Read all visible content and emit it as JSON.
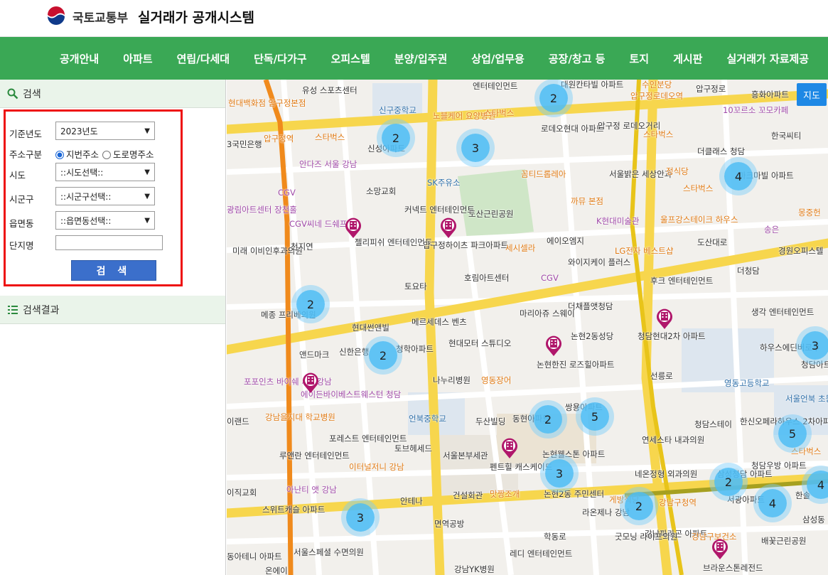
{
  "header": {
    "ministry": "국토교통부",
    "system_title": "실거래가 공개시스템"
  },
  "nav": [
    "공개안내",
    "아파트",
    "연립/다세대",
    "단독/다가구",
    "오피스텔",
    "분양/입주권",
    "상업/업무용",
    "공장/창고 등",
    "토지",
    "게시판",
    "실거래가 자료제공"
  ],
  "search": {
    "title": "검색",
    "year_label": "기준년도",
    "year_value": "2023년도",
    "addr_label": "주소구분",
    "addr_opt1": "지번주소",
    "addr_opt2": "도로명주소",
    "sido_label": "시도",
    "sido_value": "::시도선택::",
    "sigungu_label": "시군구",
    "sigungu_value": "::시군구선택::",
    "dong_label": "읍면동",
    "dong_value": "::읍면동선택::",
    "danji_label": "단지명",
    "danji_value": "",
    "button": "검 색"
  },
  "results": {
    "title": "검색결과"
  },
  "map": {
    "toggle": "지도",
    "clusters": [
      "2",
      "2",
      "3",
      "4",
      "2",
      "2",
      "2",
      "5",
      "3",
      "2",
      "4",
      "3",
      "5",
      "2",
      "3",
      "4"
    ],
    "labels": {
      "l1": "유성 스포츠센터",
      "l2": "신구중학교",
      "l3": "노블케어 요양병원",
      "l4": "스타벅스",
      "l5": "엔터테인먼트",
      "l6": "대원칸타빌 아파트",
      "l7": "로데오현대 아파트",
      "l8": "압구정 로데오거리",
      "l9": "스타벅스",
      "l10": "10꼬르소 꼬모카페",
      "l11": "흥화아파트",
      "l12": "한국씨티",
      "l13": "신성아파트",
      "l14": "현대백화점 압구정본점",
      "l15": "압구정역",
      "l16": "스타벅스",
      "l17": "3국민은행",
      "l18": "안다즈 서울 강남",
      "l19": "소망교회",
      "l20": "SK주유소",
      "l21": "도산근린공원",
      "l22": "꼼티드롭레아",
      "l23": "서울밝은 세상안과",
      "l24": "더클래스 청담",
      "l25": "정식당",
      "l26": "마크마빌 아파트",
      "l27": "스타벅스",
      "l28": "CGV",
      "l29": "광림아트센터 장천홀",
      "l30": "CGV씨네 드쉐프",
      "l31": "커넥트 엔터테인먼트",
      "l32": "까뮤 본점",
      "l33": "K현대미술관",
      "l34": "울프강스테이크 하우스",
      "l35": "송은",
      "l36": "몽중헌",
      "l37": "미래 이비인후과의원",
      "l38": "천지연",
      "l39": "젤리피쉬 엔터테인먼트",
      "l40": "압구정하이츠 파크아파트",
      "l41": "세시셀라",
      "l42": "에이오엠지",
      "l43": "LG전자 베스트샵",
      "l44": "도산대로",
      "l45": "경원오피스텔",
      "l46": "호림아트센터",
      "l47": "CGV",
      "l48": "와이지케이 플러스",
      "l49": "후크 엔터테인먼트",
      "l50": "더청담",
      "l51": "토요타",
      "l52": "메종 프리베의원",
      "l53": "현대썬앤빌",
      "l54": "메르세데스 벤츠",
      "l55": "마리아쥬 스웨이",
      "l56": "더채플앳청담",
      "l57": "생각 엔터테인먼트",
      "l58": "앤드마크",
      "l59": "신한은행",
      "l60": "청학아파트",
      "l61": "현대모터 스튜디오",
      "l62": "논현2동성당",
      "l63": "청담현대2차 아파트",
      "l64": "하우스에딘버로우",
      "l65": "포포인츠 바이쉐 서울강남",
      "l66": "에이든바이베스트웨스턴 청담",
      "l67": "나누리병원",
      "l68": "영동장어",
      "l69": "논현한진 로즈힐아파트",
      "l70": "청담아트",
      "l71": "영동고등학교",
      "l72": "강남을지대 학교병원",
      "l73": "언북중학교",
      "l74": "두산빌딩",
      "l75": "동현아파트",
      "l76": "쌍용아파트",
      "l77": "서울언북 초등학교",
      "l78": "한신오페라하우스 2차아파트",
      "l79": "이랜드",
      "l80": "포레스트 엔터테인먼트",
      "l81": "토브헤세드",
      "l82": "연세스타 내과의원",
      "l83": "청담스테이",
      "l84": "루앤란 엔터테인먼트",
      "l85": "이터널저니 강남",
      "l86": "서울본부세관",
      "l87": "펜트힐 캐스케이드",
      "l88": "논현웰스톤 아파트",
      "l89": "네온정형 외과의원",
      "l90": "삼성청담 아파트",
      "l91": "청담우방 아파트",
      "l92": "스타벅스",
      "l93": "이직교회",
      "l94": "아난티 앳 강남",
      "l95": "건설회관",
      "l96": "맛짱조개",
      "l97": "논현2동 주민센터",
      "l98": "서광아파트",
      "l99": "한솔",
      "l100": "스위트캐슬 아파트",
      "l101": "안테나",
      "l102": "면역공방",
      "l103": "라온제나 강남",
      "l104": "강남구청역",
      "l105": "게방식당",
      "l106": "삼성동 빌리",
      "l107": "강남파라곤 아파트",
      "l108": "굿모닝 라이프의원",
      "l109": "강남구보건소",
      "l110": "배꽃근린공원",
      "l111": "서울스페셜 수면의원",
      "l112": "동아테니 아파트",
      "l113": "레디 엔터테인먼트",
      "l114": "강남YK병원",
      "l115": "브라운스톤레전드",
      "l116": "온에이",
      "l117": "학동로",
      "l118": "압구정로",
      "l119": "선릉로",
      "l120": "압구정로데오역",
      "l121": "수인분당"
    }
  },
  "colors": {
    "nav": "#3aa855",
    "accent": "#3b6fcb",
    "highlight": "#ee1111",
    "road_major": "#f7d64d",
    "line_orange": "#f08a1c",
    "line_yellow": "#e8c41a"
  }
}
